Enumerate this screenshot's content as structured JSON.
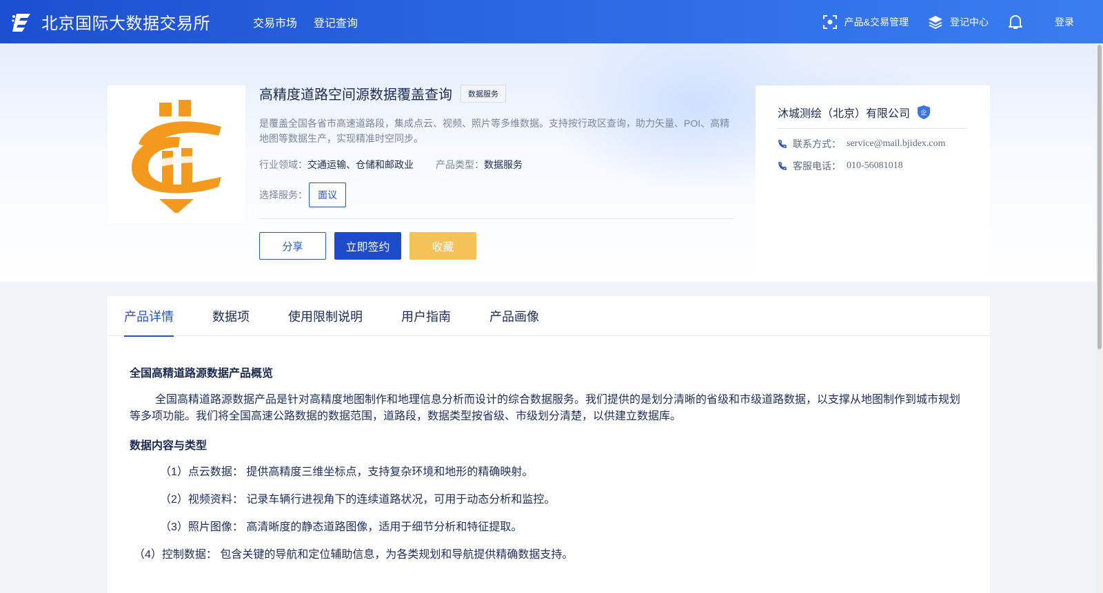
{
  "header": {
    "brand_name": "北京国际大数据交易所",
    "nav": [
      "交易市场",
      "登记查询"
    ],
    "product_mgmt": "产品&交易管理",
    "register_center": "登记中心",
    "login": "登录"
  },
  "product": {
    "title": "高精度道路空间源数据覆盖查询",
    "badge": "数据服务",
    "description": "是覆盖全国各省市高速道路段，集成点云、视频、照片等多维数据。支持按行政区查询，助力矢量、POI、高精地图等数据生产，实现精准时空同步。",
    "industry_label": "行业领域：",
    "industry_value": "交通运输、仓储和邮政业",
    "type_label": "产品类型：",
    "type_value": "数据服务",
    "service_label": "选择服务：",
    "service_option": "面议",
    "buttons": {
      "share": "分享",
      "sign": "立即签约",
      "favorite": "收藏"
    }
  },
  "company": {
    "name": "沐城测绘（北京）有限公司",
    "badge": "企",
    "contact_label": "联系方式：",
    "contact_value": "service@mail.bjidex.com",
    "phone_label": "客服电话：",
    "phone_value": "010-56081018"
  },
  "tabs": [
    "产品详情",
    "数据项",
    "使用限制说明",
    "用户指南",
    "产品画像"
  ],
  "active_tab": "产品详情",
  "article": {
    "heading1": "全国高精道路源数据产品概览",
    "para1": "全国高精道路源数据产品是针对高精度地图制作和地理信息分析而设计的综合数据服务。我们提供的是划分清晰的省级和市级道路数据，以支撑从地图制作到城市规划等多项功能。我们将全国高速公路数据的数据范围，道路段，数据类型按省级、市级划分清楚，以供建立数据库。",
    "heading2": "数据内容与类型",
    "items": [
      "（1）点云数据： 提供高精度三维坐标点，支持复杂环境和地形的精确映射。",
      "（2）视频资料： 记录车辆行进视角下的连续道路状况，可用于动态分析和监控。",
      "（3）照片图像： 高清晰度的静态道路图像，适用于细节分析和特征提取。",
      "（4）控制数据： 包含关键的导航和定位辅助信息，为各类规划和导航提供精确数据支持。"
    ]
  },
  "colors": {
    "primary": "#1e4bc9",
    "accent_link": "#2a52be",
    "favorite": "#f5c25a",
    "logo_orange": "#f39a1e"
  }
}
